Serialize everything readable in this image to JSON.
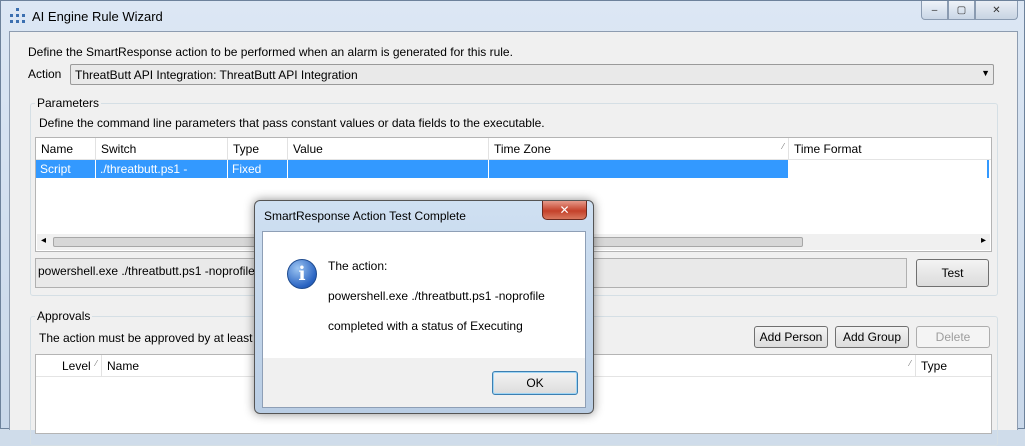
{
  "window": {
    "title": "AI Engine Rule Wizard",
    "buttons": {
      "minimize": "–",
      "maximize": "▢",
      "close": "✕"
    }
  },
  "description": "Define the SmartResponse action to be performed when an alarm is generated for this rule.",
  "action": {
    "label": "Action",
    "selected": "ThreatButt API Integration: ThreatButt API Integration",
    "dropdown_glyph": "▼"
  },
  "parameters": {
    "group_label": "Parameters",
    "description": "Define the command line parameters that pass constant values or data fields to the executable.",
    "columns": [
      "Name",
      "Switch",
      "Type",
      "Value",
      "Time Zone",
      "Time Format"
    ],
    "rows": [
      {
        "name": "Script",
        "switch": "./threatbutt.ps1 -noprofile",
        "type": "Fixed",
        "value": "",
        "time_zone": "",
        "time_format": ""
      }
    ],
    "command_line": "powershell.exe ./threatbutt.ps1 -noprofile",
    "test_button": "Test",
    "scroll_left": "◂",
    "scroll_right": "▸"
  },
  "approvals": {
    "group_label": "Approvals",
    "description": "The action must be approved by at least one p",
    "add_person": "Add Person",
    "add_group": "Add Group",
    "delete": "Delete",
    "columns": [
      "Level",
      "Name",
      "Type"
    ]
  },
  "dialog": {
    "title": "SmartResponse Action Test Complete",
    "close": "✕",
    "icon": "i",
    "line1": "The action:",
    "line2": "powershell.exe ./threatbutt.ps1 -noprofile",
    "line3": "completed with a status of Executing",
    "ok": "OK"
  },
  "colors": {
    "selection": "#3399ff",
    "title_bar": "#dce7f4",
    "close_red": "#c4412a"
  }
}
